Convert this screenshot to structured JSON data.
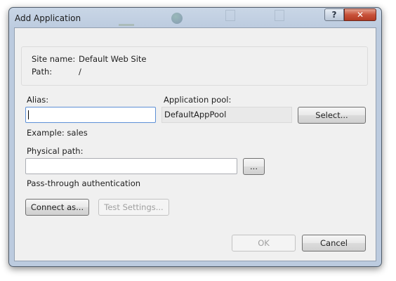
{
  "window": {
    "title": "Add Application",
    "help_button": "?",
    "close_button": "✕"
  },
  "site_info": {
    "site_name_label": "Site name:",
    "site_name_value": "Default Web Site",
    "path_label": "Path:",
    "path_value": "/"
  },
  "alias": {
    "label": "Alias:",
    "value": "",
    "example": "Example: sales"
  },
  "app_pool": {
    "label": "Application pool:",
    "value": "DefaultAppPool",
    "select_button": "Select..."
  },
  "physical_path": {
    "label": "Physical path:",
    "value": "",
    "browse_button": "..."
  },
  "auth": {
    "label": "Pass-through authentication",
    "connect_button": "Connect as...",
    "test_button": "Test Settings..."
  },
  "footer": {
    "ok_button": "OK",
    "cancel_button": "Cancel"
  },
  "colors": {
    "title_bar": "#bccbdf",
    "close_button": "#c8523a",
    "dialog_bg": "#f0f0f0",
    "focus_border": "#5d8fd6"
  }
}
